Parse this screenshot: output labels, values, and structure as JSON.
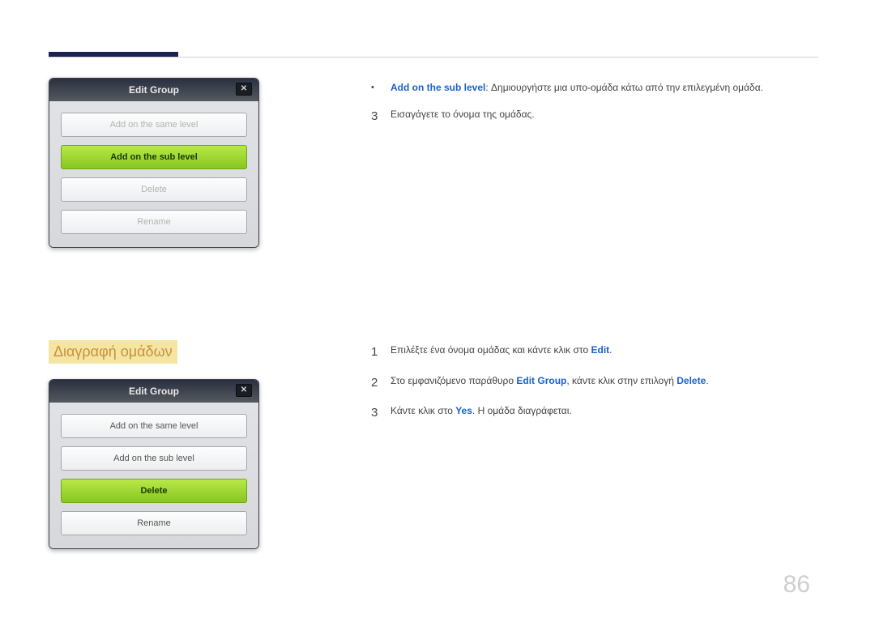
{
  "page_number": "86",
  "section_title": "Διαγραφή ομάδων",
  "dialog": {
    "title": "Edit Group",
    "close": "✕",
    "options": {
      "same": "Add on the same level",
      "sub": "Add on the sub level",
      "delete": "Delete",
      "rename": "Rename"
    }
  },
  "instr1": {
    "bullet_kw": "Add on the sub level",
    "bullet_rest": ": Δημιουργήστε μια υπο-ομάδα κάτω από την επιλεγμένη ομάδα.",
    "step3": "Εισαγάγετε το όνομα της ομάδας."
  },
  "instr2": {
    "s1_a": "Επιλέξτε ένα όνομα ομάδας και κάντε κλικ στο ",
    "s1_kw": "Edit",
    "s1_b": ".",
    "s2_a": "Στο εμφανιζόμενο παράθυρο ",
    "s2_kw1": "Edit Group",
    "s2_b": ", κάντε κλικ στην επιλογή ",
    "s2_kw2": "Delete",
    "s2_c": ".",
    "s3_a": "Κάντε κλικ στο ",
    "s3_kw": "Yes",
    "s3_b": ". Η ομάδα διαγράφεται."
  },
  "nums": {
    "n1": "1",
    "n2": "2",
    "n3": "3"
  }
}
